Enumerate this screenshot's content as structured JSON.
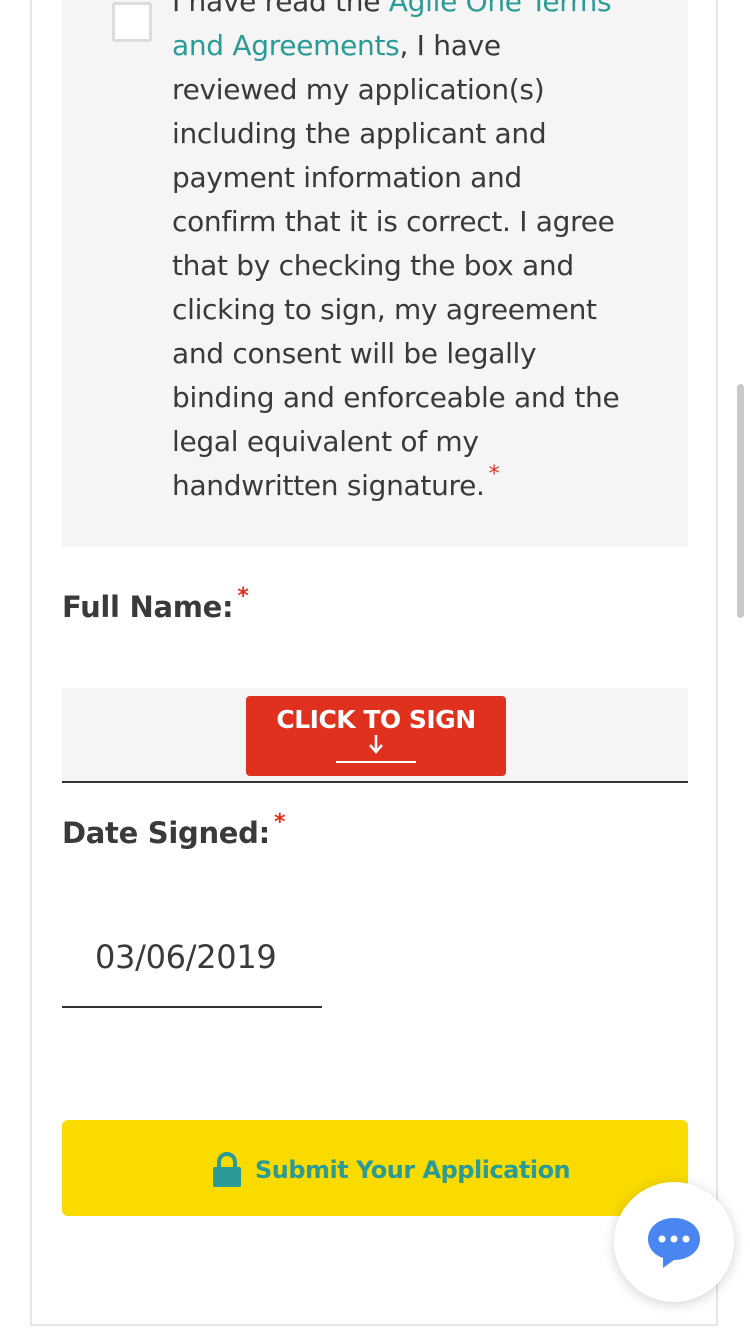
{
  "terms": {
    "text_before_link": "I have read the ",
    "link_text": "Agile One Terms and Agreements",
    "text_after_link": ", I have reviewed my application(s) including the applicant and payment information and confirm that it is correct. I agree that by checking the box and clicking to sign, my agreement and consent will be legally binding and enforceable and the legal equivalent of my handwritten signature.",
    "required_marker": "*",
    "checked": false
  },
  "full_name": {
    "label": "Full Name:",
    "required_marker": "*",
    "sign_button_label": "CLICK TO SIGN",
    "sign_icon": "arrow-down-icon"
  },
  "date_signed": {
    "label": "Date Signed:",
    "required_marker": "*",
    "value": "03/06/2019"
  },
  "submit": {
    "label": "Submit Your Application",
    "icon": "lock-icon"
  },
  "chat": {
    "icon": "chat-bubble-icon"
  },
  "colors": {
    "accent_teal": "#2b9b96",
    "sign_red": "#e0301e",
    "submit_yellow": "#fadb00",
    "chat_blue": "#4a86f0"
  }
}
